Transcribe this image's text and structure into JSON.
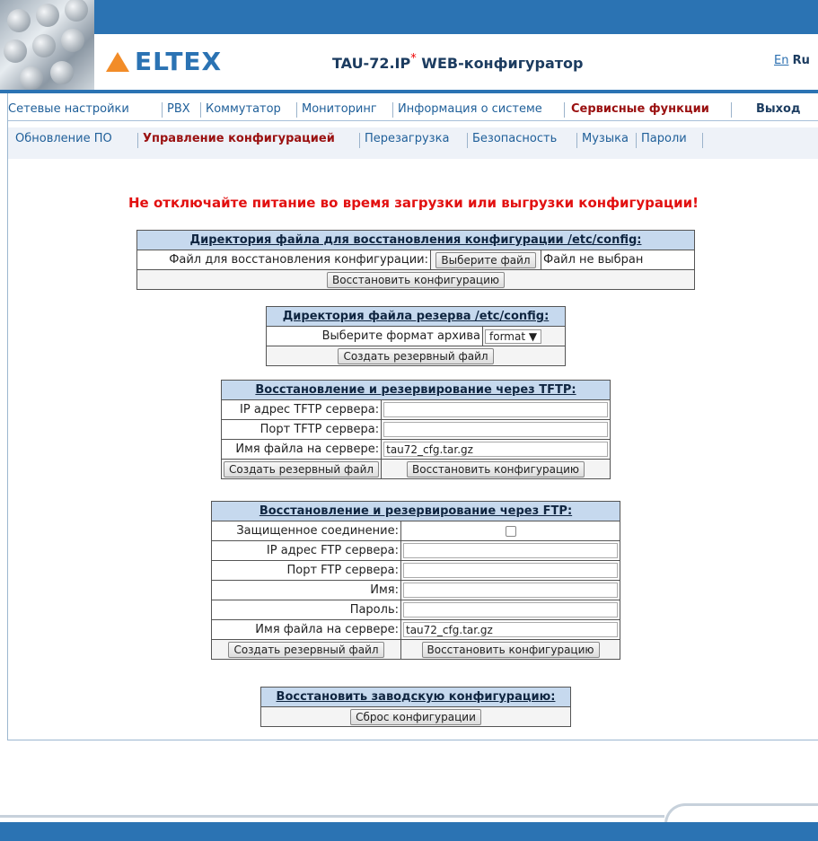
{
  "header": {
    "logo": "ELTEX",
    "title": "TAU-72.IP",
    "title_mark": "*",
    "title_suffix": " WEB-конфигуратор",
    "lang_en": "En",
    "lang_ru": "Ru"
  },
  "nav_main": [
    "Сетевые настройки",
    "PBX",
    "Коммутатор",
    "Мониторинг",
    "Информация о системе",
    "Сервисные функции",
    "Выход"
  ],
  "nav_sub": [
    "Обновление ПО",
    "Управление конфигурацией",
    "Перезагрузка",
    "Безопасность",
    "Музыка",
    "Пароли"
  ],
  "warning": "Не отключайте питание во время загрузки или выгрузки конфигурации!",
  "restore": {
    "header": "Директория файла для восстановления конфигурации /etc/config:",
    "file_label": "Файл для восстановления конфигурации:",
    "choose_btn": "Выберите файл",
    "no_file": "Файл не выбран",
    "restore_btn": "Восстановить конфигурацию"
  },
  "backup": {
    "header": "Директория файла резерва /etc/config:",
    "format_label": "Выберите формат архива",
    "format_value": "format",
    "create_btn": "Создать резервный файл"
  },
  "tftp": {
    "header": "Восстановление и резервирование через TFTP:",
    "ip_label": "IP адрес TFTP сервера:",
    "ip_value": "",
    "port_label": "Порт TFTP сервера:",
    "port_value": "",
    "file_label": "Имя файла на сервере:",
    "file_value": "tau72_cfg.tar.gz",
    "create_btn": "Создать резервный файл",
    "restore_btn": "Восстановить конфигурацию"
  },
  "ftp": {
    "header": "Восстановление и резервирование через FTP:",
    "secure_label": "Защищенное соединение:",
    "secure_checked": false,
    "ip_label": "IP адрес FTP сервера:",
    "ip_value": "",
    "port_label": "Порт FTP сервера:",
    "port_value": "",
    "name_label": "Имя:",
    "name_value": "",
    "pass_label": "Пароль:",
    "pass_value": "",
    "file_label": "Имя файла на сервере:",
    "file_value": "tau72_cfg.tar.gz",
    "create_btn": "Создать резервный файл",
    "restore_btn": "Восстановить конфигурацию"
  },
  "factory": {
    "header": "Восстановить заводскую конфигурацию:",
    "reset_btn": "Сброс конфигурации"
  }
}
